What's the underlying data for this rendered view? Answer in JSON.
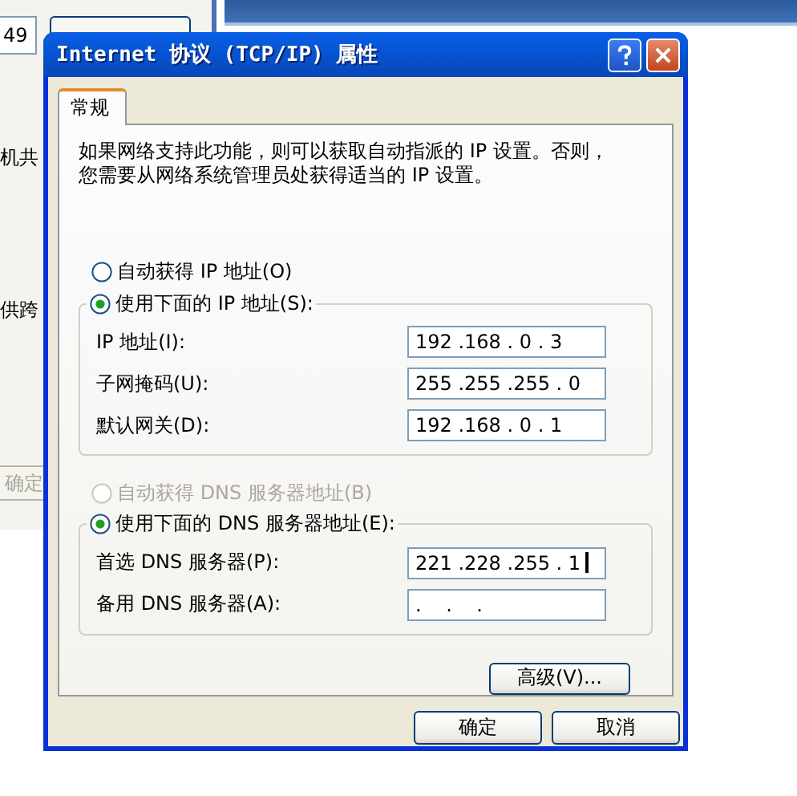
{
  "background_window": {
    "field_value": "49",
    "text_1": "机共",
    "text_2": "供跨",
    "ok_button": "确定"
  },
  "dialog": {
    "title": "Internet 协议 (TCP/IP) 属性",
    "tabs": [
      {
        "label": "常规",
        "selected": true
      }
    ],
    "intro": [
      "如果网络支持此功能，则可以获取自动指派的 IP 设置。否则，",
      "您需要从网络系统管理员处获得适当的 IP 设置。"
    ],
    "ip_mode": [
      {
        "label": "自动获得 IP 地址(O)",
        "selected": false,
        "disabled": false
      },
      {
        "label": "使用下面的 IP 地址(S):",
        "selected": true,
        "disabled": false
      }
    ],
    "ip_fields": [
      {
        "label": "IP 地址(I):",
        "value": "192 .168 . 0 . 3",
        "focused": false
      },
      {
        "label": "子网掩码(U):",
        "value": "255 .255 .255 . 0",
        "focused": false
      },
      {
        "label": "默认网关(D):",
        "value": "192 .168 . 0 . 1",
        "focused": false
      }
    ],
    "dns_mode": [
      {
        "label": "自动获得 DNS 服务器地址(B)",
        "selected": false,
        "disabled": true
      },
      {
        "label": "使用下面的 DNS 服务器地址(E):",
        "selected": true,
        "disabled": false
      }
    ],
    "dns_fields": [
      {
        "label": "首选 DNS 服务器(P):",
        "value": "221 .228 .255 . 1",
        "focused": true
      },
      {
        "label": "备用 DNS 服务器(A):",
        "value": ".    .    .",
        "focused": false
      }
    ],
    "advanced_button": "高级(V)...",
    "buttons": [
      "确定",
      "取消"
    ]
  }
}
